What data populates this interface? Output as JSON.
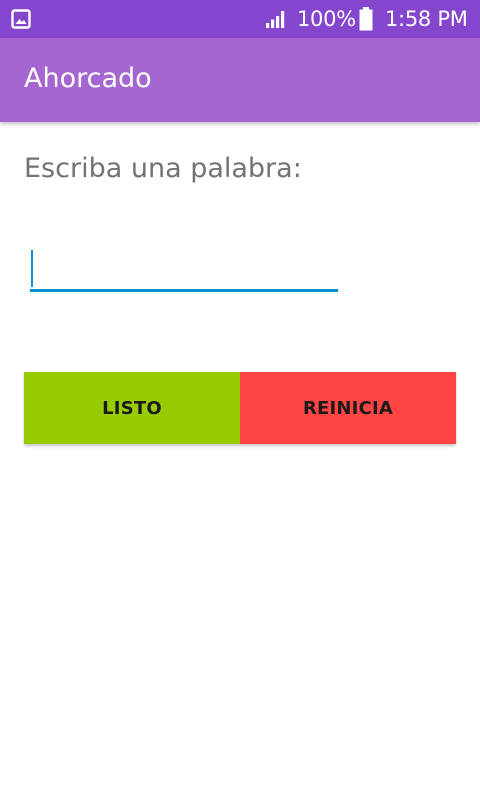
{
  "status_bar": {
    "left_icon": "gallery-icon",
    "signal_icon": "signal-icon",
    "battery_percent": "100%",
    "battery_icon": "battery-icon",
    "time": "1:58 PM",
    "background_color": "#8446cc"
  },
  "app_bar": {
    "title": "Ahorcado",
    "background_color": "#a666d1"
  },
  "main": {
    "prompt": "Escriba una palabra:",
    "word_input": {
      "value": "",
      "placeholder": "",
      "accent_color": "#0a8fcf"
    },
    "buttons": {
      "listo": {
        "label": "LISTO",
        "color": "#99cc00"
      },
      "reinicia": {
        "label": "REINICIA",
        "color": "#ff4444"
      }
    }
  }
}
